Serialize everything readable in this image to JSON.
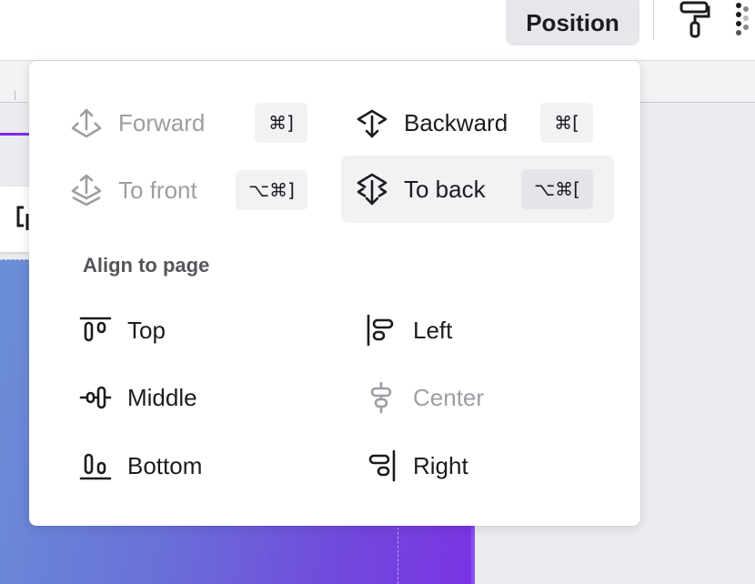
{
  "toolbar": {
    "position_label": "Position",
    "paint_roller_icon": "paint-roller-icon",
    "transparency_icon": "checkerboard-icon"
  },
  "menu": {
    "layer_items": [
      {
        "label": "Forward",
        "shortcut": "⌘]",
        "icon": "bring-forward-icon",
        "disabled": true
      },
      {
        "label": "Backward",
        "shortcut": "⌘[",
        "icon": "send-backward-icon",
        "disabled": false
      },
      {
        "label": "To front",
        "shortcut": "⌥⌘]",
        "icon": "bring-to-front-icon",
        "disabled": true
      },
      {
        "label": "To back",
        "shortcut": "⌥⌘[",
        "icon": "send-to-back-icon",
        "disabled": false,
        "highlighted": true
      }
    ],
    "align_section_title": "Align to page",
    "align_items": [
      {
        "label": "Top",
        "icon": "align-top-icon",
        "disabled": false
      },
      {
        "label": "Left",
        "icon": "align-left-icon",
        "disabled": false
      },
      {
        "label": "Middle",
        "icon": "align-middle-icon",
        "disabled": false
      },
      {
        "label": "Center",
        "icon": "align-center-icon",
        "disabled": true
      },
      {
        "label": "Bottom",
        "icon": "align-bottom-icon",
        "disabled": false
      },
      {
        "label": "Right",
        "icon": "align-right-icon",
        "disabled": false
      }
    ]
  },
  "colors": {
    "accent": "#7d2ae8",
    "text": "#1b1c20",
    "disabled_text": "#9d9ea3",
    "gradient_start": "#6b8fd6",
    "gradient_end": "#7a34e3"
  }
}
